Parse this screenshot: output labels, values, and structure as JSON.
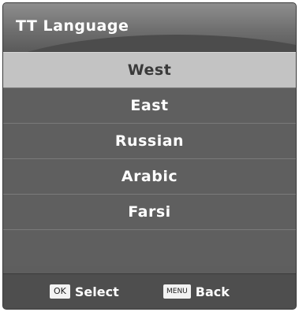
{
  "header": {
    "title": "TT Language"
  },
  "items": [
    {
      "label": "West",
      "selected": true
    },
    {
      "label": "East"
    },
    {
      "label": "Russian"
    },
    {
      "label": "Arabic"
    },
    {
      "label": "Farsi"
    }
  ],
  "footer": {
    "select": {
      "key": "OK",
      "label": "Select"
    },
    "back": {
      "key": "MENU",
      "label": "Back"
    }
  },
  "colors": {
    "selected_bg": "#c3c3c3",
    "item_bg": "#5f5f5f",
    "footer_bg": "#4e4e4e"
  }
}
